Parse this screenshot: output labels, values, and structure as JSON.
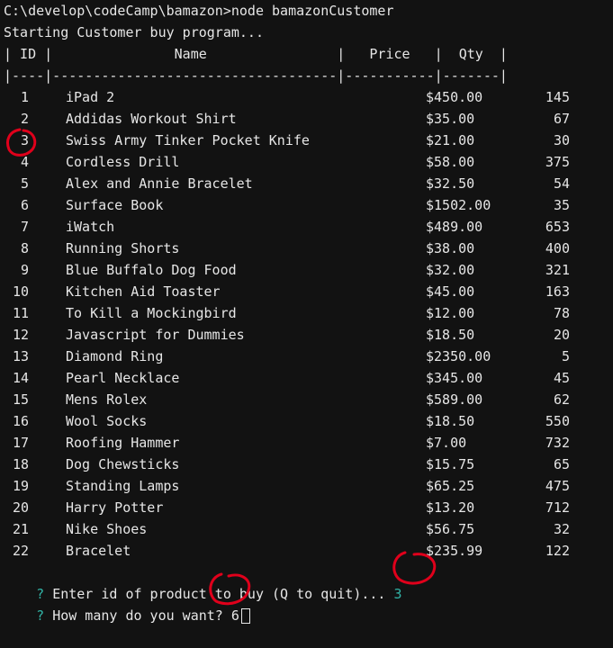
{
  "terminal": {
    "command_line": "C:\\develop\\codeCamp\\bamazon>node bamazonCustomer",
    "status_line": "Starting Customer buy program...",
    "table_header_line": "| ID |               Name                |   Price   |  Qty  |",
    "table_separator_line": "|----|-----------------------------------|-----------|-------|",
    "rows": [
      {
        "id": "1",
        "name": "iPad 2",
        "price": "$450.00",
        "qty": "145"
      },
      {
        "id": "2",
        "name": "Addidas Workout Shirt",
        "price": "$35.00",
        "qty": "67"
      },
      {
        "id": "3",
        "name": "Swiss Army Tinker Pocket Knife",
        "price": "$21.00",
        "qty": "30"
      },
      {
        "id": "4",
        "name": "Cordless Drill",
        "price": "$58.00",
        "qty": "375"
      },
      {
        "id": "5",
        "name": "Alex and Annie Bracelet",
        "price": "$32.50",
        "qty": "54"
      },
      {
        "id": "6",
        "name": "Surface Book",
        "price": "$1502.00",
        "qty": "35"
      },
      {
        "id": "7",
        "name": "iWatch",
        "price": "$489.00",
        "qty": "653"
      },
      {
        "id": "8",
        "name": "Running Shorts",
        "price": "$38.00",
        "qty": "400"
      },
      {
        "id": "9",
        "name": "Blue Buffalo Dog Food",
        "price": "$32.00",
        "qty": "321"
      },
      {
        "id": "10",
        "name": "Kitchen Aid Toaster",
        "price": "$45.00",
        "qty": "163"
      },
      {
        "id": "11",
        "name": "To Kill a Mockingbird",
        "price": "$12.00",
        "qty": "78"
      },
      {
        "id": "12",
        "name": "Javascript for Dummies",
        "price": "$18.50",
        "qty": "20"
      },
      {
        "id": "13",
        "name": "Diamond Ring",
        "price": "$2350.00",
        "qty": "5"
      },
      {
        "id": "14",
        "name": "Pearl Necklace",
        "price": "$345.00",
        "qty": "45"
      },
      {
        "id": "15",
        "name": "Mens Rolex",
        "price": "$589.00",
        "qty": "62"
      },
      {
        "id": "16",
        "name": "Wool Socks",
        "price": "$18.50",
        "qty": "550"
      },
      {
        "id": "17",
        "name": "Roofing Hammer",
        "price": "$7.00",
        "qty": "732"
      },
      {
        "id": "18",
        "name": "Dog Chewsticks",
        "price": "$15.75",
        "qty": "65"
      },
      {
        "id": "19",
        "name": "Standing Lamps",
        "price": "$65.25",
        "qty": "475"
      },
      {
        "id": "20",
        "name": "Harry Potter",
        "price": "$13.20",
        "qty": "712"
      },
      {
        "id": "21",
        "name": "Nike Shoes",
        "price": "$56.75",
        "qty": "32"
      },
      {
        "id": "22",
        "name": "Bracelet",
        "price": "$235.99",
        "qty": "122"
      }
    ],
    "prompt_1": {
      "mark": "?",
      "question": "Enter id of product to buy (Q to quit)...",
      "answer": "3"
    },
    "prompt_2": {
      "mark": "?",
      "question": "How many do you want?",
      "answer": "6"
    }
  },
  "colors": {
    "background": "#121212",
    "text": "#e6e6e6",
    "prompt_accent": "#31b3a6",
    "annotation": "#e0001b"
  }
}
